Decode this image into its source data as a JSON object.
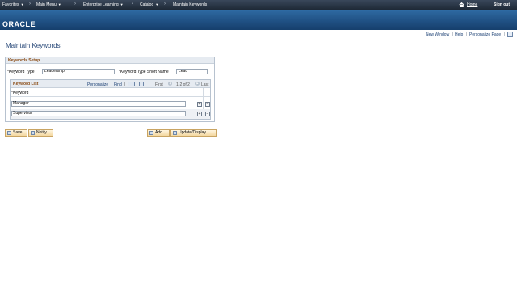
{
  "topnav": {
    "favorites": "Favorites",
    "main_menu": "Main Menu",
    "enterprise_learning": "Enterprise Learning",
    "catalog": "Catalog",
    "current": "Maintain Keywords",
    "home": "Home",
    "sign_out": "Sign out"
  },
  "banner": {
    "logo": "ORACLE"
  },
  "utility": {
    "new_window": "New Window",
    "help": "Help",
    "personalize_page": "Personalize Page"
  },
  "page_title": "Maintain Keywords",
  "setup": {
    "title": "Keywords Setup",
    "keyword_type_label": "*Keyword Type",
    "keyword_type_value": "Leadership",
    "short_name_label": "*Keyword Type Short Name",
    "short_name_value": "Lead"
  },
  "grid": {
    "title": "Keyword List",
    "personalize": "Personalize",
    "find": "Find",
    "first": "First",
    "range": "1-2 of 2",
    "last": "Last",
    "column": "*Keyword",
    "rows": [
      "Manager",
      "Supervisor"
    ],
    "add_symbol": "+",
    "delete_symbol": "−"
  },
  "buttons": {
    "save": "Save",
    "notify": "Notify",
    "add": "Add",
    "update_display": "Update/Display"
  }
}
